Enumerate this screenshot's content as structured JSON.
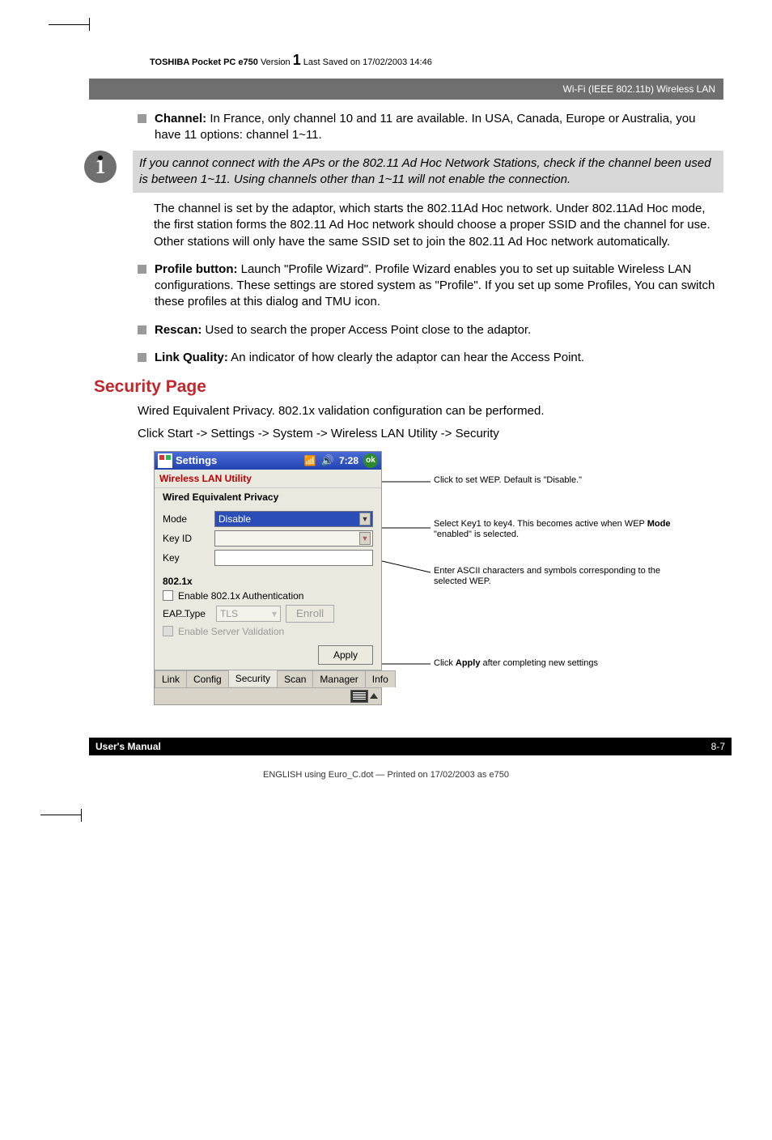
{
  "header": {
    "brand": "TOSHIBA Pocket PC e750",
    "version_label": "Version",
    "version_num": "1",
    "saved": "Last Saved on 17/02/2003 14:46"
  },
  "chapter_bar": "Wi-Fi (IEEE 802.11b) Wireless LAN",
  "bullets": {
    "channel_label": "Channel:",
    "channel_text": " In France, only channel 10 and 11 are available. In USA, Canada, Europe or Australia, you have 11 options: channel 1~11.",
    "profile_label": "Profile button:",
    "profile_text": " Launch \"Profile Wizard\". Profile Wizard enables you to set up suitable Wireless LAN configurations. These settings are stored system as \"Profile\". If you set up some Profiles, You can switch these profiles at this dialog and TMU icon.",
    "rescan_label": "Rescan:",
    "rescan_text": " Used to search the proper Access Point close to the adaptor.",
    "link_label": "Link Quality:",
    "link_text": " An indicator of how clearly the adaptor can hear the Access Point."
  },
  "note": "If you cannot connect with the APs or the 802.11 Ad Hoc Network Stations, check if the channel been used is between 1~11. Using channels other than 1~11 will not enable the connection.",
  "para_after_note": "The channel is set by the adaptor, which starts the 802.11Ad Hoc network. Under 802.11Ad Hoc mode, the first station forms the 802.11 Ad Hoc network should choose a proper SSID and the channel for use. Other stations will only have the same SSID set to join the 802.11 Ad Hoc network automatically.",
  "security": {
    "heading": "Security Page",
    "p1": "Wired Equivalent Privacy. 802.1x validation configuration can be performed.",
    "p2": "Click Start -> Settings -> System -> Wireless LAN Utility -> Security"
  },
  "screenshot": {
    "titlebar": "Settings",
    "time": "7:28",
    "ok": "ok",
    "app_title": "Wireless LAN Utility",
    "wep_header": "Wired Equivalent Privacy",
    "labels": {
      "mode": "Mode",
      "keyid": "Key ID",
      "key": "Key",
      "eaptype": "EAP Type"
    },
    "mode_value": "Disable",
    "section_8021x": "802.1x",
    "chk_enable_auth": "Enable 802.1x Authentication",
    "eap_value": "TLS",
    "enroll_btn": "Enroll",
    "chk_server_validation": "Enable Server Validation",
    "apply": "Apply",
    "tabs": [
      "Link",
      "Config",
      "Security",
      "Scan",
      "Manager",
      "Info"
    ]
  },
  "callouts": {
    "c1": "Click to set WEP. Default is \"Disable.\"",
    "c2a": "Select Key1 to key4. This becomes active when WEP ",
    "c2b": "Mode",
    "c2c": " \"enabled\" is selected.",
    "c3": "Enter ASCII characters and symbols corresponding to the selected WEP.",
    "c4a": "Click ",
    "c4b": "Apply",
    "c4c": " after completing new settings"
  },
  "footer": {
    "left": "User's Manual",
    "right": "8-7"
  },
  "print_line": "ENGLISH using Euro_C.dot — Printed on 17/02/2003 as e750"
}
